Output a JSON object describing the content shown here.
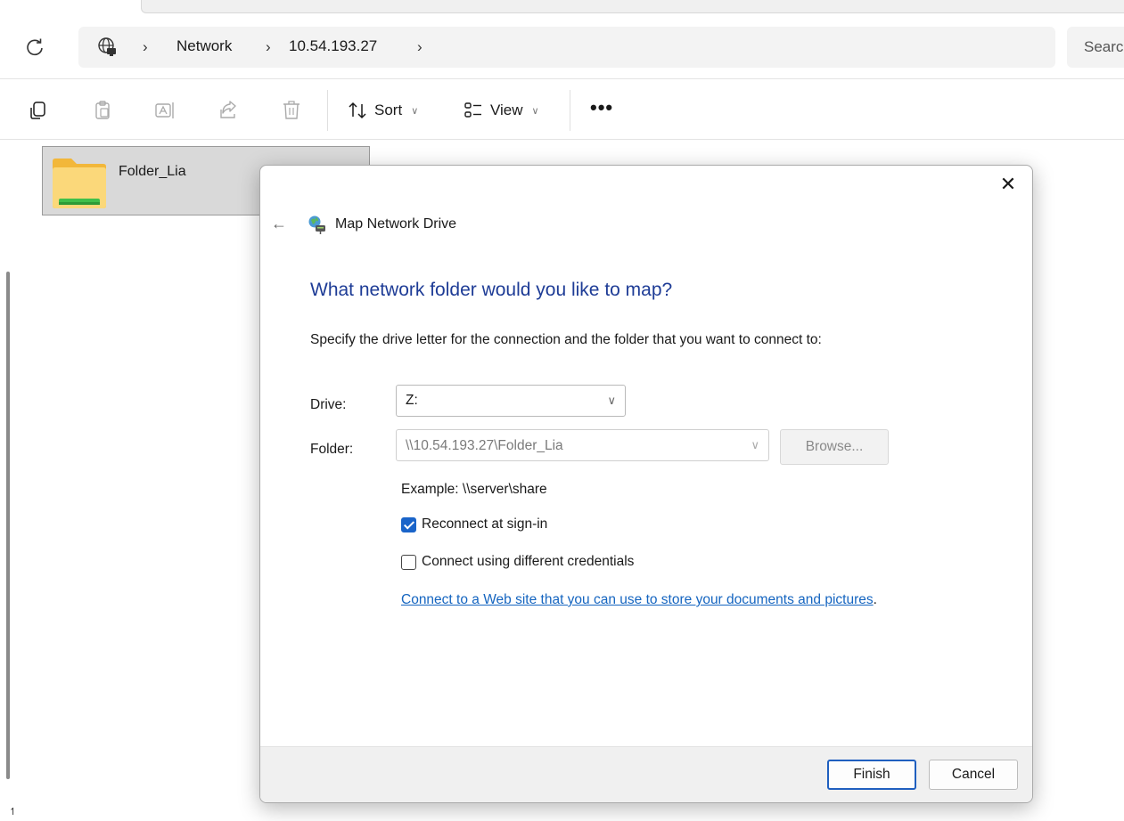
{
  "explorer": {
    "breadcrumb": {
      "items": [
        "Network",
        "10.54.193.27"
      ],
      "separator": "›"
    },
    "search": {
      "placeholder": "Search"
    },
    "toolbar": {
      "sort_label": "Sort",
      "view_label": "View",
      "more_label": "•••"
    },
    "items": [
      {
        "name": "Folder_Lia",
        "icon": "folder-icon"
      }
    ],
    "edge_glyph": "↿"
  },
  "dialog": {
    "title": "Map Network Drive",
    "close_glyph": "✕",
    "back_glyph": "←",
    "heading": "What network folder would you like to map?",
    "instruction": "Specify the drive letter for the connection and the folder that you want to connect to:",
    "drive": {
      "label": "Drive:",
      "value": "Z:"
    },
    "folder": {
      "label": "Folder:",
      "value": "\\\\10.54.193.27\\Folder_Lia"
    },
    "browse_label": "Browse...",
    "example": "Example: \\\\server\\share",
    "reconnect": {
      "label": "Reconnect at sign-in",
      "checked": true
    },
    "different_credentials": {
      "label": "Connect using different credentials",
      "checked": false
    },
    "web_link": {
      "text": "Connect to a Web site that you can use to store your documents and pictures",
      "suffix": "."
    },
    "finish_label": "Finish",
    "cancel_label": "Cancel"
  },
  "colors": {
    "heading": "#1e3c96",
    "link": "#1565c0",
    "checkbox_accent": "#1a64c9",
    "primary_border": "#1f5fbf",
    "selection_bg": "#d9d9d9"
  }
}
